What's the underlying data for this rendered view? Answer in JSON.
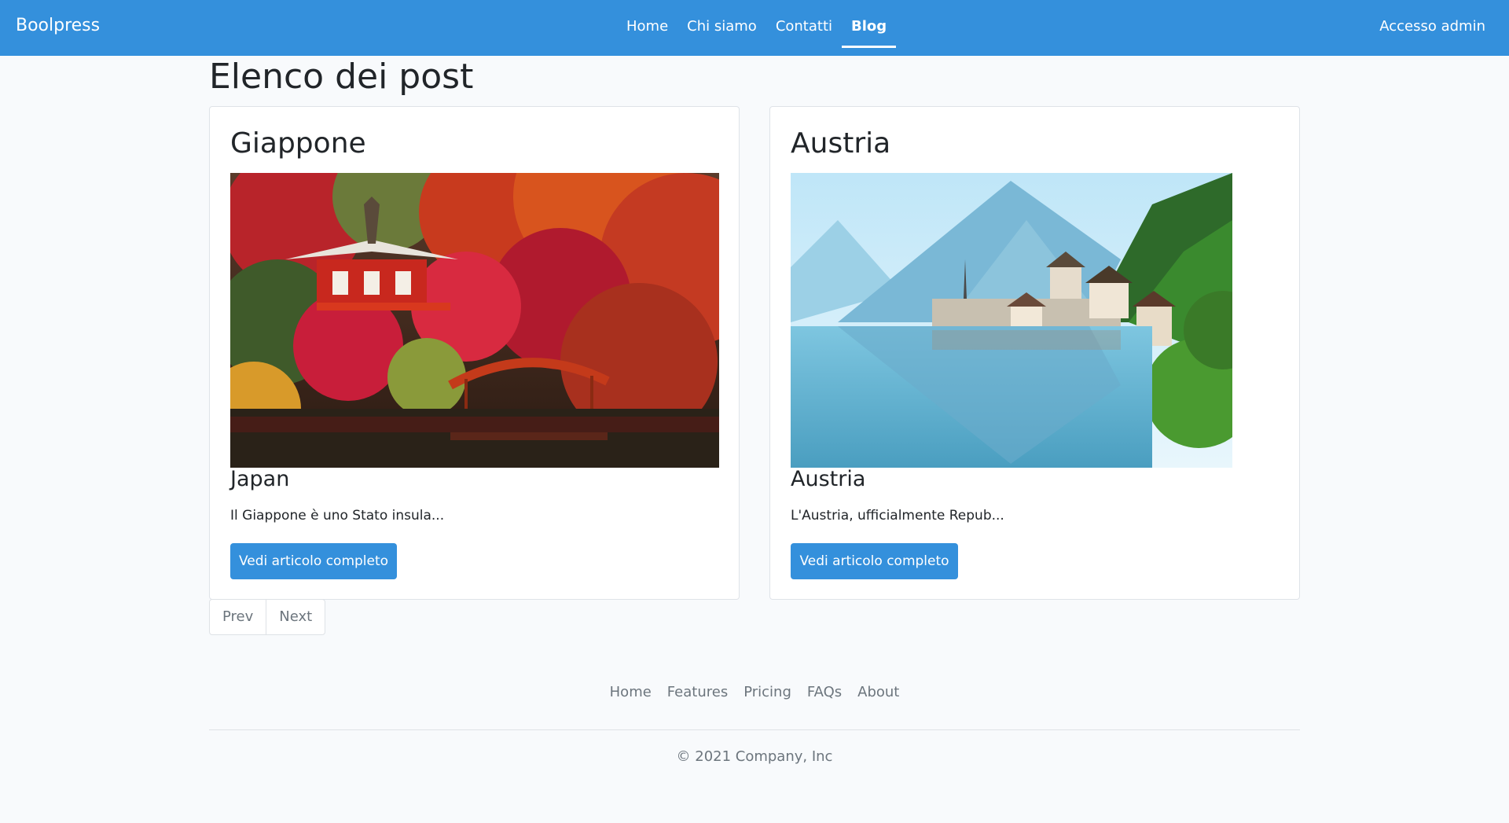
{
  "navbar": {
    "brand": "Boolpress",
    "links": [
      "Home",
      "Chi siamo",
      "Contatti",
      "Blog"
    ],
    "active": "Blog",
    "admin": "Accesso admin",
    "color": "#3490dc"
  },
  "page": {
    "title": "Elenco dei post"
  },
  "posts": [
    {
      "title": "Giappone",
      "subtitle": "Japan",
      "excerpt": "Il Giappone è uno Stato insula...",
      "button": "Vedi articolo completo",
      "image": "japanese-temple-autumn-photo"
    },
    {
      "title": "Austria",
      "subtitle": "Austria",
      "excerpt": "L'Austria, ufficialmente Repub...",
      "button": "Vedi articolo completo",
      "image": "hallstatt-lake-village-photo"
    }
  ],
  "pagination": {
    "prev": "Prev",
    "next": "Next"
  },
  "footer": {
    "links": [
      "Home",
      "Features",
      "Pricing",
      "FAQs",
      "About"
    ],
    "copyright": "© 2021 Company, Inc"
  }
}
